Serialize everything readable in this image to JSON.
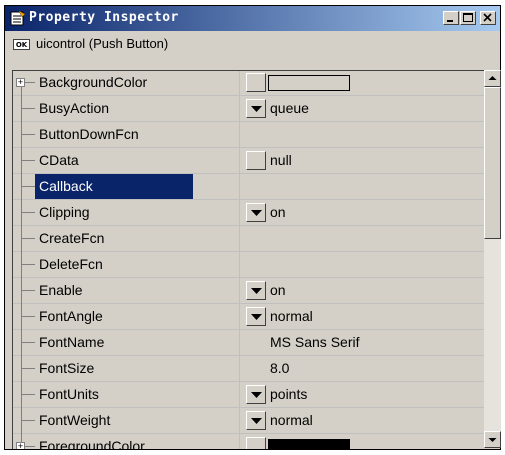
{
  "window": {
    "title": "Property Inspector",
    "object_badge": "OK",
    "object_label": "uicontrol (Push Button)"
  },
  "properties": [
    {
      "name": "BackgroundColor",
      "expandable": true,
      "control": "square",
      "value": "",
      "swatch": "#d4d0c8"
    },
    {
      "name": "BusyAction",
      "control": "dropdown",
      "value": "queue"
    },
    {
      "name": "ButtonDownFcn",
      "control": "none",
      "value": ""
    },
    {
      "name": "CData",
      "control": "square",
      "value": "null"
    },
    {
      "name": "Callback",
      "control": "none",
      "value": "",
      "selected": true
    },
    {
      "name": "Clipping",
      "control": "dropdown",
      "value": "on"
    },
    {
      "name": "CreateFcn",
      "control": "none",
      "value": ""
    },
    {
      "name": "DeleteFcn",
      "control": "none",
      "value": ""
    },
    {
      "name": "Enable",
      "control": "dropdown",
      "value": "on"
    },
    {
      "name": "FontAngle",
      "control": "dropdown",
      "value": "normal"
    },
    {
      "name": "FontName",
      "control": "none",
      "value": "MS Sans Serif"
    },
    {
      "name": "FontSize",
      "control": "none",
      "value": "8.0"
    },
    {
      "name": "FontUnits",
      "control": "dropdown",
      "value": "points"
    },
    {
      "name": "FontWeight",
      "control": "dropdown",
      "value": "normal"
    },
    {
      "name": "ForegroundColor",
      "expandable": true,
      "control": "square",
      "value": "",
      "swatch": "#000000"
    }
  ],
  "colors": {
    "title_start": "#0a246a",
    "title_end": "#a6caf0",
    "selection": "#0a246a",
    "face": "#d4d0c8"
  },
  "icons": {
    "app": "property-inspector-icon",
    "minimize": "minimize-icon",
    "maximize": "maximize-icon",
    "close": "close-icon"
  }
}
